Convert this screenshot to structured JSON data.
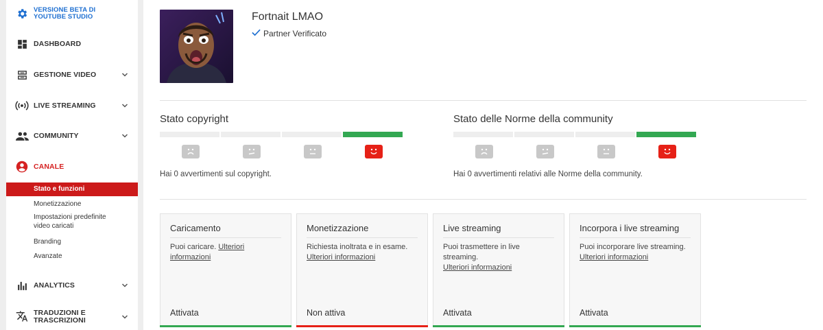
{
  "sidebar": {
    "beta": {
      "label_line1": "VERSIONE BETA DI",
      "label_line2": "YOUTUBE STUDIO",
      "icon": "gear-icon"
    },
    "items": [
      {
        "label": "DASHBOARD",
        "icon": "dashboard-icon"
      },
      {
        "label": "GESTIONE VIDEO",
        "icon": "video-manager-icon"
      },
      {
        "label": "LIVE STREAMING",
        "icon": "live-icon"
      },
      {
        "label": "COMMUNITY",
        "icon": "people-icon"
      },
      {
        "label": "CANALE",
        "icon": "account-circle-icon"
      },
      {
        "label": "ANALYTICS",
        "icon": "bar-chart-icon"
      },
      {
        "label_line1": "TRADUZIONI E",
        "label_line2": "TRASCRIZIONI",
        "icon": "translate-icon"
      }
    ],
    "canale_sub": [
      {
        "label": "Stato e funzioni"
      },
      {
        "label": "Monetizzazione"
      },
      {
        "label_line1": "Impostazioni predefinite",
        "label_line2": "video caricati"
      },
      {
        "label": "Branding"
      },
      {
        "label": "Avanzate"
      }
    ]
  },
  "channel": {
    "name": "Fortnait LMAO",
    "partner": "Partner Verificato"
  },
  "copyright": {
    "title": "Stato copyright",
    "text": "Hai 0 avvertimenti sul copyright.",
    "level": 4,
    "levels_total": 4
  },
  "community": {
    "title": "Stato delle Norme della community",
    "text": "Hai 0 avvertimenti relativi alle Norme della community.",
    "level": 4,
    "levels_total": 4
  },
  "cards": [
    {
      "title": "Caricamento",
      "desc": "Puoi caricare.",
      "link": "Ulteriori informazioni",
      "status": "Attivata",
      "status_color": "#33a852"
    },
    {
      "title": "Monetizzazione",
      "desc": "Richiesta inoltrata e in esame.",
      "link": "Ulteriori informazioni",
      "status": "Non attiva",
      "status_color": "#e62117"
    },
    {
      "title": "Live streaming",
      "desc": "Puoi trasmettere in live streaming.",
      "link": "Ulteriori informazioni",
      "status": "Attivata",
      "status_color": "#33a852"
    },
    {
      "title": "Incorpora i live streaming",
      "desc": "Puoi incorporare live streaming.",
      "link": "Ulteriori informazioni",
      "status": "Attivata",
      "status_color": "#33a852"
    }
  ],
  "colors": {
    "accent_red": "#cc1a1a",
    "beta_blue": "#1e6fd1",
    "ok_green": "#33a852"
  }
}
